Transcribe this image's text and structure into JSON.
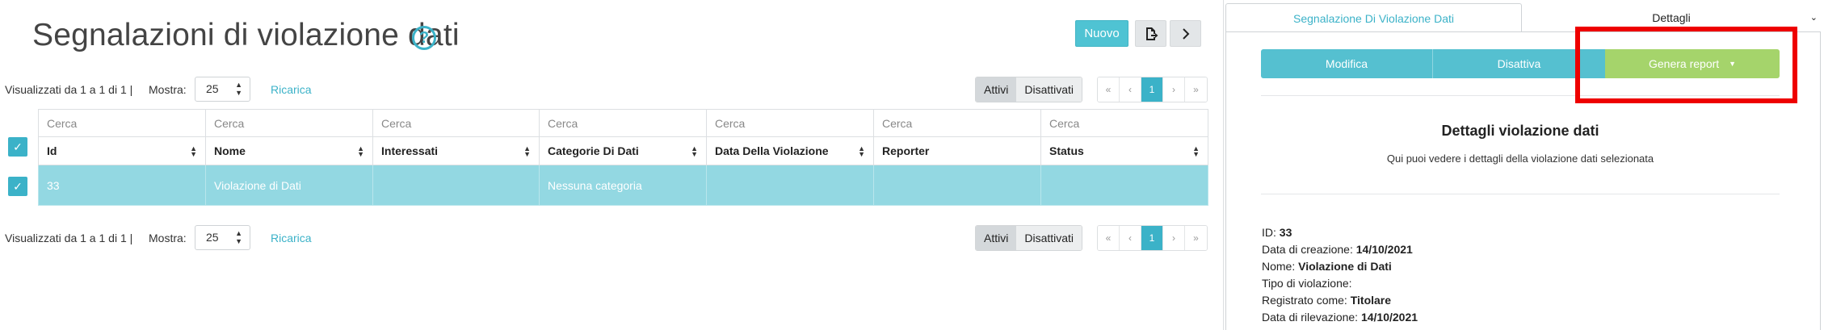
{
  "page": {
    "title": "Segnalazioni di violazione dati",
    "help_icon": "question-circle-icon",
    "toolbar": {
      "new_label": "Nuovo",
      "export_icon": "export-file-icon",
      "next_icon": "chevron-right-icon"
    }
  },
  "list_controls": {
    "summary": "Visualizzati da 1 a 1 di 1 |",
    "show_label": "Mostra:",
    "page_size": "25",
    "reload_label": "Ricarica",
    "filter_active": "Attivi",
    "filter_inactive": "Disattivati",
    "pager": [
      "«",
      "‹",
      "1",
      "›",
      "»"
    ]
  },
  "table": {
    "search_placeholder": "Cerca",
    "columns": [
      "Id",
      "Nome",
      "Interessati",
      "Categorie Di Dati",
      "Data Della Violazione",
      "Reporter",
      "Status"
    ],
    "rows": [
      [
        "33",
        "Violazione di Dati",
        "",
        "Nessuna categoria",
        "",
        "",
        ""
      ]
    ]
  },
  "panel": {
    "tabs": [
      "Segnalazione Di Violazione Dati",
      "Dettagli"
    ],
    "actions": {
      "edit": "Modifica",
      "disable": "Disattiva",
      "report": "Genera report"
    },
    "details_title": "Dettagli violazione dati",
    "details_subtitle": "Qui puoi vedere i dettagli della violazione dati selezionata",
    "fields": [
      {
        "label": "ID:",
        "value": "33"
      },
      {
        "label": "Data di creazione:",
        "value": "14/10/2021"
      },
      {
        "label": "Nome:",
        "value": "Violazione di Dati"
      },
      {
        "label": "Tipo di violazione:",
        "value": ""
      },
      {
        "label": "Registrato come:",
        "value": "Titolare"
      },
      {
        "label": "Data di rilevazione:",
        "value": "14/10/2021"
      }
    ]
  },
  "colors": {
    "accent": "#3bb2c8",
    "selected_row": "#93d8e2",
    "report_button": "#a5d46b",
    "highlight": "#ee0000"
  }
}
